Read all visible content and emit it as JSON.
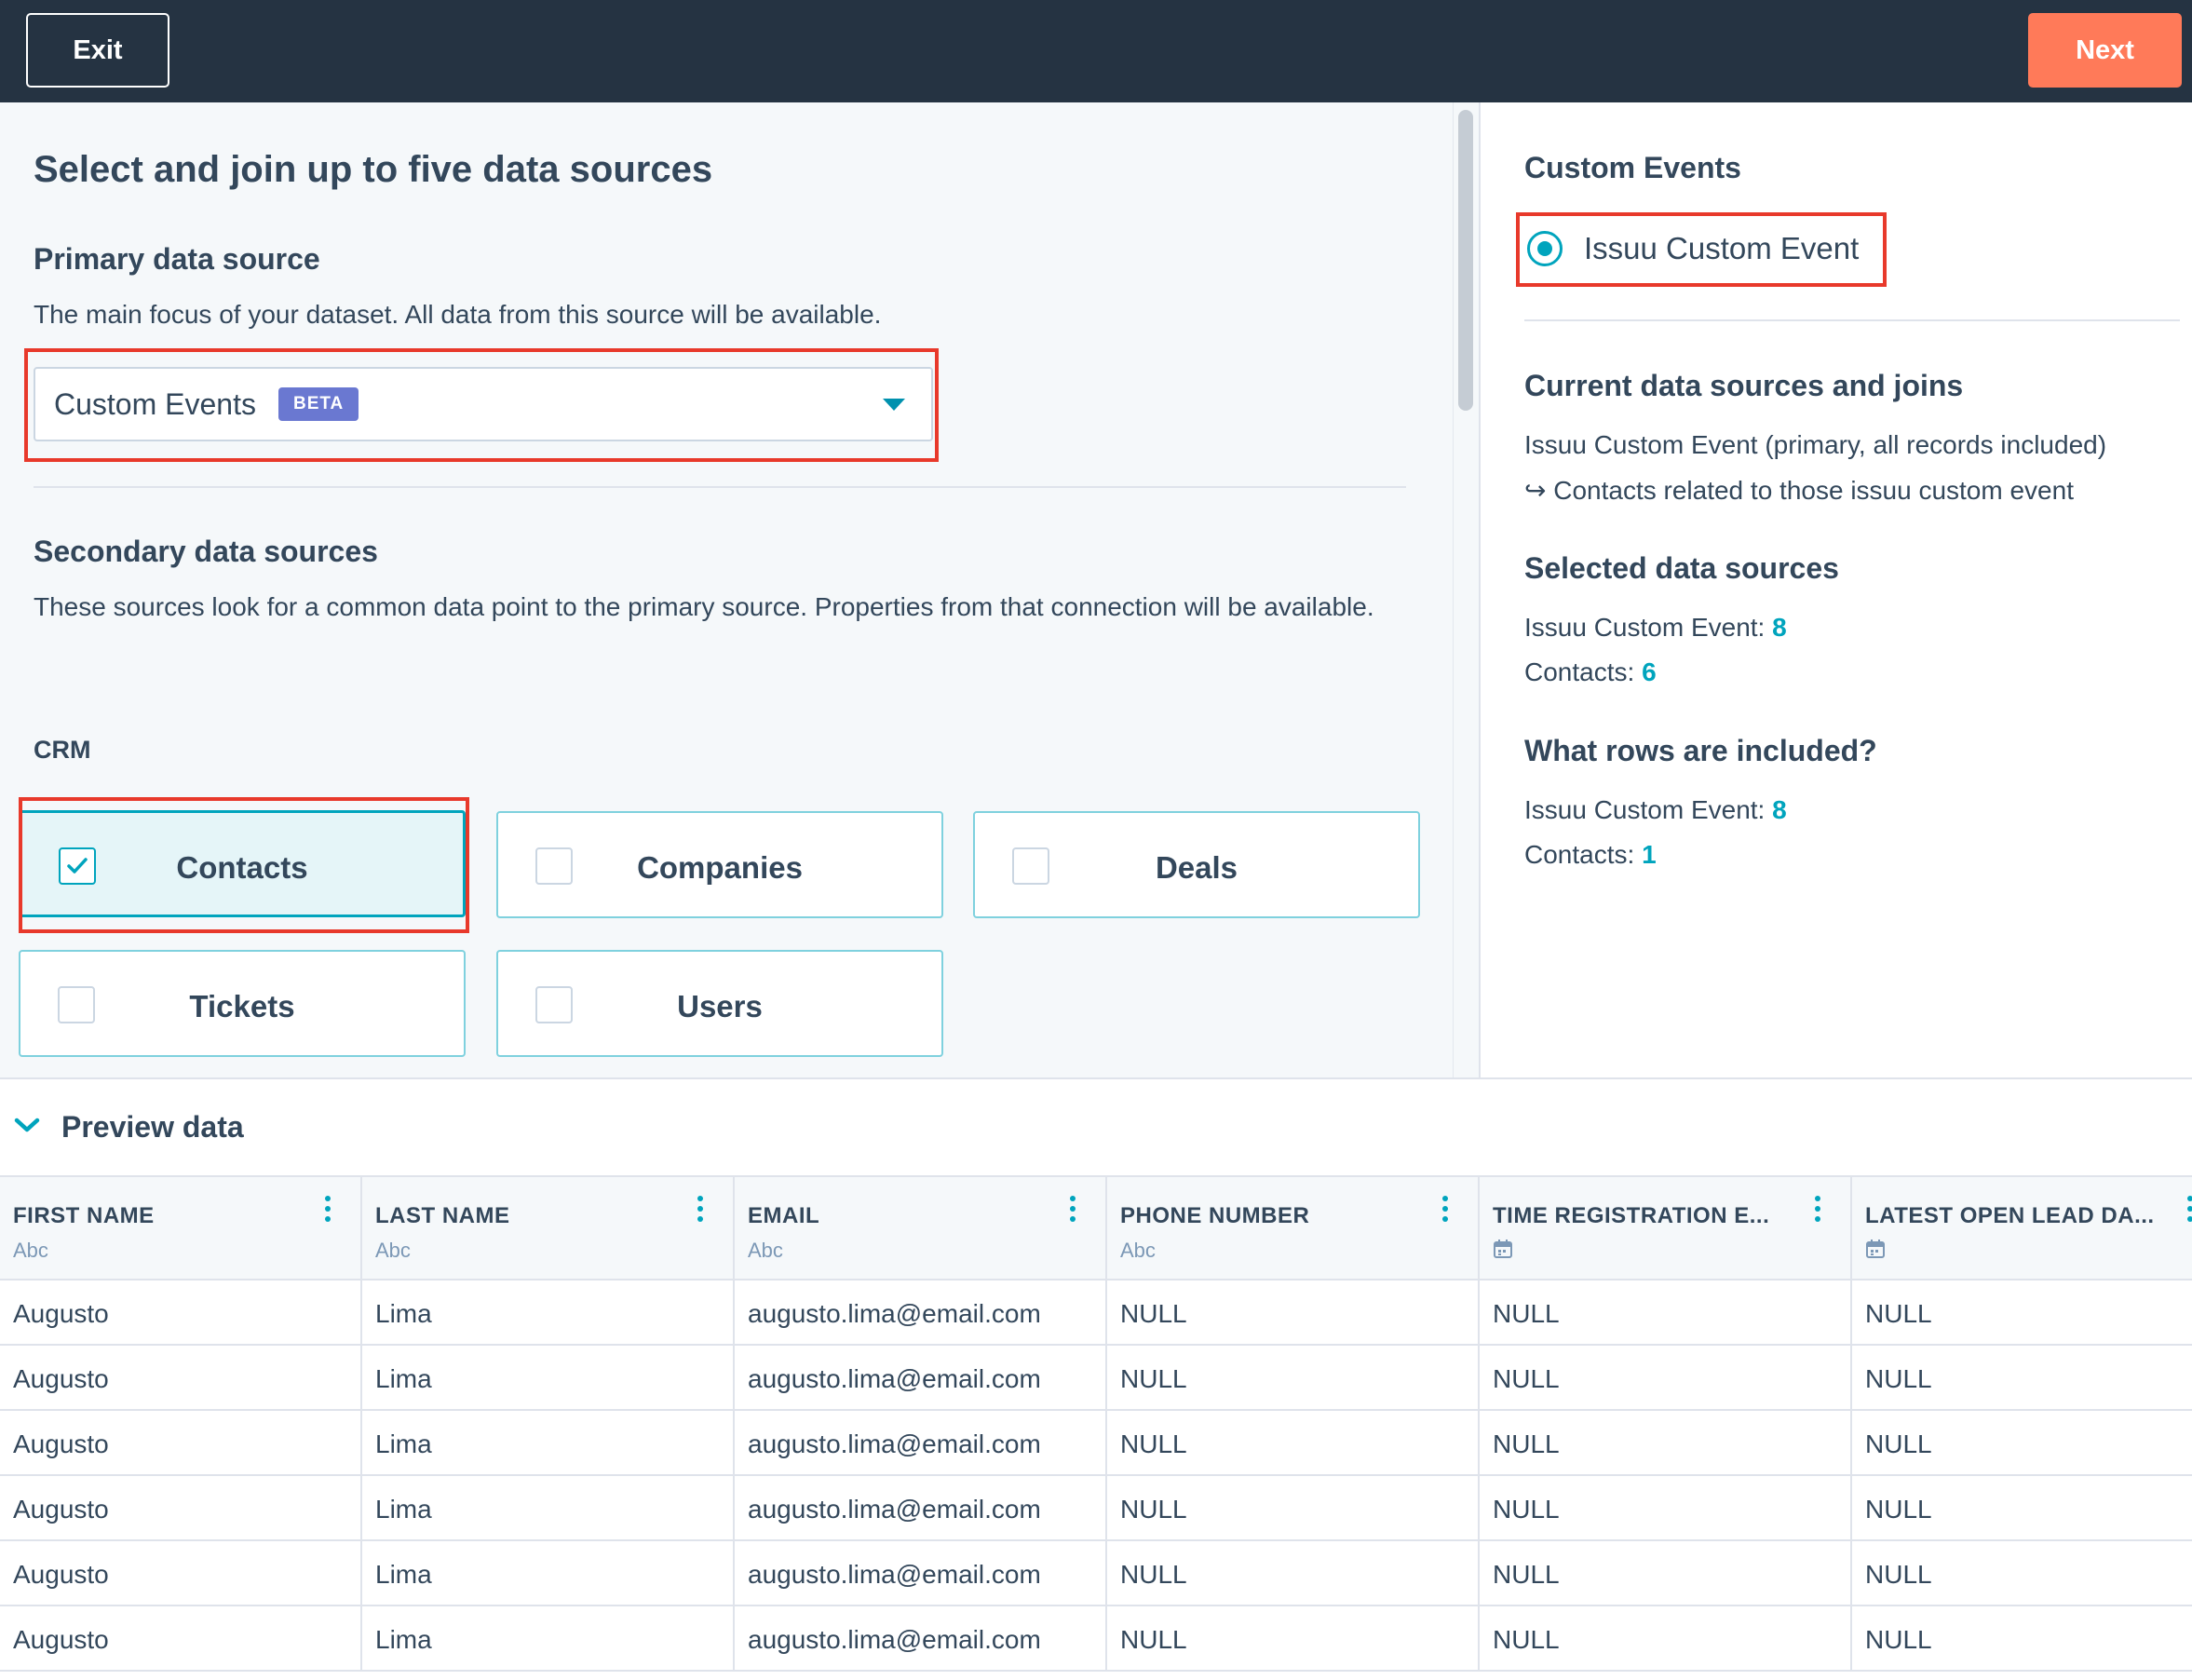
{
  "topbar": {
    "exit_label": "Exit",
    "next_label": "Next"
  },
  "left": {
    "title": "Select and join up to five data sources",
    "primary": {
      "heading": "Primary data source",
      "description": "The main focus of your dataset. All data from this source will be available.",
      "selected_value": "Custom Events",
      "badge": "BETA"
    },
    "secondary": {
      "heading": "Secondary data sources",
      "description": "These sources look for a common data point to the primary source. Properties from that connection will be available."
    },
    "crm_label": "CRM",
    "sources": [
      {
        "label": "Contacts",
        "checked": true
      },
      {
        "label": "Companies",
        "checked": false
      },
      {
        "label": "Deals",
        "checked": false
      },
      {
        "label": "Tickets",
        "checked": false
      },
      {
        "label": "Users",
        "checked": false
      }
    ]
  },
  "right": {
    "custom_events_heading": "Custom Events",
    "radio_option": "Issuu Custom Event",
    "joins_heading": "Current data sources and joins",
    "join_primary": "Issuu Custom Event (primary, all records included)",
    "join_related": "↪ Contacts related to those issuu custom event",
    "selected_heading": "Selected data sources",
    "selected": [
      {
        "label": "Issuu Custom Event:",
        "value": "8"
      },
      {
        "label": "Contacts:",
        "value": "6"
      }
    ],
    "rows_heading": "What rows are included?",
    "rows": [
      {
        "label": "Issuu Custom Event:",
        "value": "8"
      },
      {
        "label": "Contacts:",
        "value": "1"
      }
    ]
  },
  "preview": {
    "title": "Preview data",
    "columns": [
      {
        "title": "FIRST NAME",
        "type": "Abc",
        "type_icon": ""
      },
      {
        "title": "LAST NAME",
        "type": "Abc",
        "type_icon": ""
      },
      {
        "title": "EMAIL",
        "type": "Abc",
        "type_icon": ""
      },
      {
        "title": "PHONE NUMBER",
        "type": "Abc",
        "type_icon": ""
      },
      {
        "title": "TIME REGISTRATION E...",
        "type": "",
        "type_icon": "calendar-icon"
      },
      {
        "title": "LATEST OPEN LEAD DA...",
        "type": "",
        "type_icon": "calendar-icon"
      }
    ],
    "rows": [
      [
        "Augusto",
        "Lima",
        "augusto.lima@email.com",
        "NULL",
        "NULL",
        "NULL"
      ],
      [
        "Augusto",
        "Lima",
        "augusto.lima@email.com",
        "NULL",
        "NULL",
        "NULL"
      ],
      [
        "Augusto",
        "Lima",
        "augusto.lima@email.com",
        "NULL",
        "NULL",
        "NULL"
      ],
      [
        "Augusto",
        "Lima",
        "augusto.lima@email.com",
        "NULL",
        "NULL",
        "NULL"
      ],
      [
        "Augusto",
        "Lima",
        "augusto.lima@email.com",
        "NULL",
        "NULL",
        "NULL"
      ],
      [
        "Augusto",
        "Lima",
        "augusto.lima@email.com",
        "NULL",
        "NULL",
        "NULL"
      ]
    ]
  },
  "colors": {
    "topbar": "#253342",
    "accent": "#00a4bd",
    "next_button": "#ff7a59",
    "badge": "#6a78d1",
    "highlight": "#e8392b"
  }
}
